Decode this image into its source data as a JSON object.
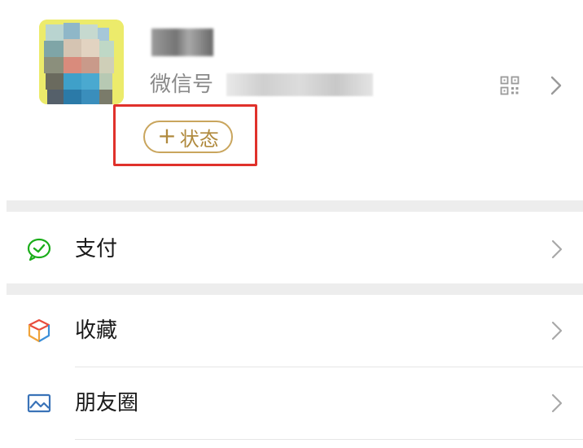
{
  "profile": {
    "wechat_id_label": "微信号",
    "status_plus": "+",
    "status_label": "状态",
    "avatar_icon": "avatar",
    "qr_icon": "qr-code-icon",
    "chevron_icon": "chevron-right-icon"
  },
  "menu": {
    "items": [
      {
        "label": "支付",
        "icon": "pay-icon",
        "icon_color": "#1aad19"
      },
      {
        "label": "收藏",
        "icon": "favorites-cube-icon",
        "icon_color": "#f0a33a"
      },
      {
        "label": "朋友圈",
        "icon": "moments-picture-icon",
        "icon_color": "#3a73b8"
      }
    ]
  },
  "colors": {
    "status_border": "#c9a55d",
    "status_text": "#b08a3e",
    "highlight_box": "#e0312b",
    "separator": "#ededed"
  }
}
